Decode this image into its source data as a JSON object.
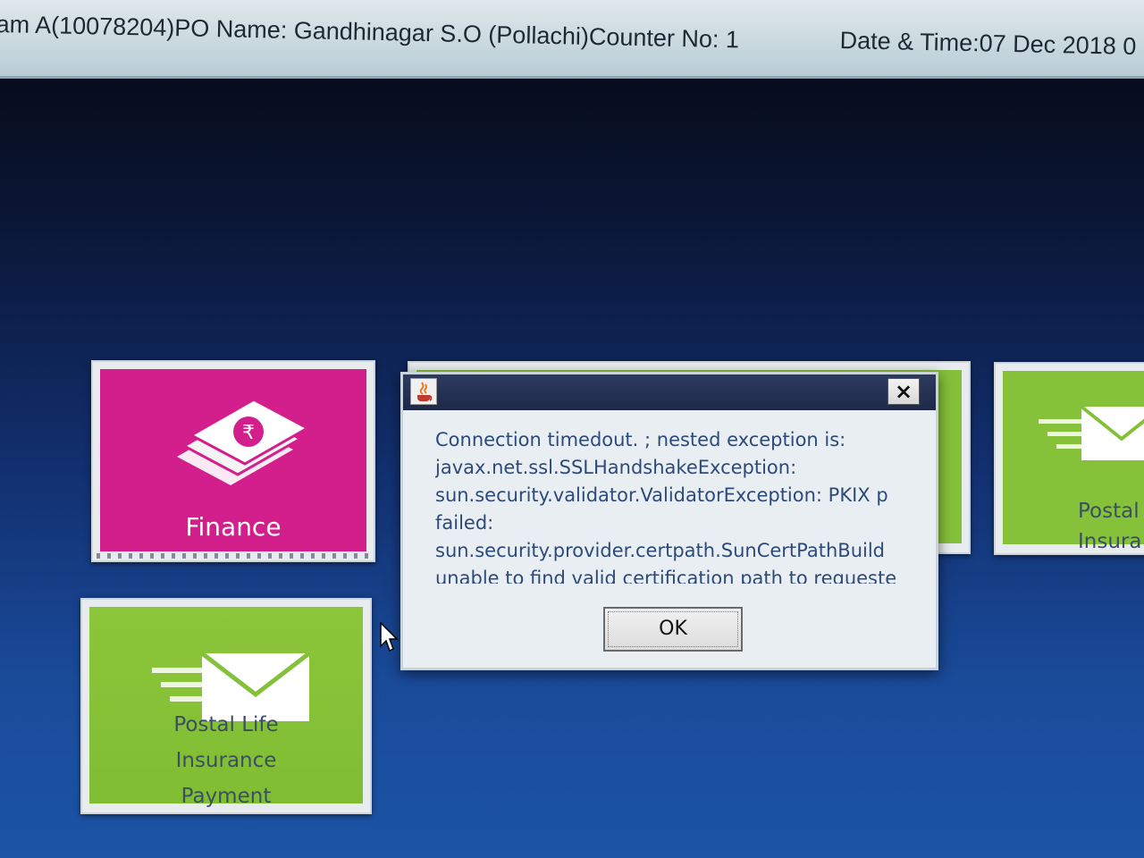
{
  "header": {
    "title_text": "am A(10078204)PO Name: Gandhinagar S.O (Pollachi)Counter No: 1",
    "datetime_text": "Date & Time:07 Dec 2018 0"
  },
  "tiles": {
    "finance": {
      "label": "Finance",
      "color": "#d31f8c"
    },
    "pli_payment": {
      "label_lines": [
        "Postal Life",
        "Insurance",
        "Payment"
      ],
      "color": "#84c03a"
    },
    "postal_insurance": {
      "label_lines": [
        "Postal",
        "Insura"
      ],
      "color": "#84c03a"
    }
  },
  "dialog": {
    "icon": "java-icon",
    "close_label": "×",
    "message_lines": [
      "Connection timedout. ; nested exception is:",
      "javax.net.ssl.SSLHandshakeException:",
      "sun.security.validator.ValidatorException: PKIX p",
      "failed:",
      "sun.security.provider.certpath.SunCertPathBuild",
      "unable to find valid certification path to requeste"
    ],
    "ok_label": "OK"
  }
}
